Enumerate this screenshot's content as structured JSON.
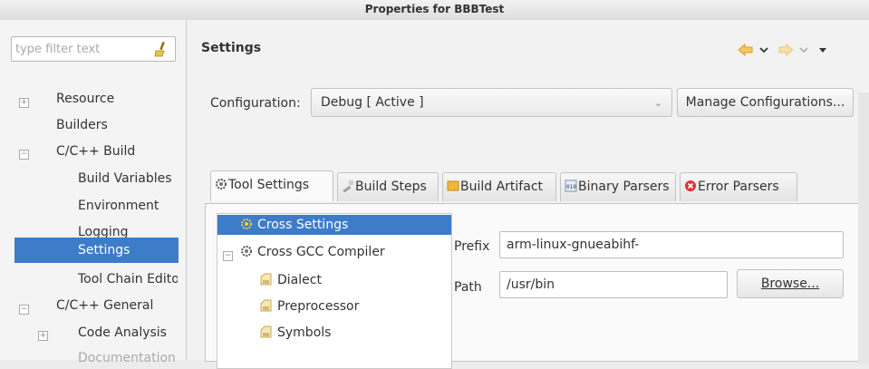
{
  "window": {
    "title": "Properties for BBBTest"
  },
  "filter": {
    "placeholder": "type filter text",
    "icon": "clear-filter-icon"
  },
  "nav_tree": [
    {
      "label": "Resource",
      "expander": "+"
    },
    {
      "label": "Builders"
    },
    {
      "label": "C/C++ Build",
      "expander": "−"
    },
    {
      "label": "Build Variables"
    },
    {
      "label": "Environment"
    },
    {
      "label": "Logging"
    },
    {
      "label": "Settings",
      "selected": true
    },
    {
      "label": "Tool Chain Edito"
    },
    {
      "label": "C/C++ General",
      "expander": "−"
    },
    {
      "label": "Code Analysis",
      "expander": "+"
    },
    {
      "label": "Documentation"
    }
  ],
  "page": {
    "title": "Settings"
  },
  "configuration": {
    "label": "Configuration:",
    "value": "Debug  [ Active ]",
    "manage_button": "Manage Configurations..."
  },
  "tabs": [
    {
      "label": "Tool Settings",
      "icon": "gear-icon",
      "active": true
    },
    {
      "label": "Build Steps",
      "icon": "hammer-icon"
    },
    {
      "label": "Build Artifact",
      "icon": "artifact-icon"
    },
    {
      "label": "Binary Parsers",
      "icon": "binary-icon"
    },
    {
      "label": "Error Parsers",
      "icon": "error-icon"
    }
  ],
  "settings_tree": [
    {
      "label": "Cross Settings",
      "selected": true
    },
    {
      "label": "Cross GCC Compiler",
      "expander": "−"
    },
    {
      "label": "Dialect"
    },
    {
      "label": "Preprocessor"
    },
    {
      "label": "Symbols"
    }
  ],
  "fields": {
    "prefix_label": "Prefix",
    "prefix_value": "arm-linux-gnueabihf-",
    "path_label": "Path",
    "path_value": "/usr/bin",
    "browse_button": "Browse..."
  },
  "colors": {
    "selection": "#3d7cc8",
    "nav_arrow": "#e8a317",
    "error": "#e03030"
  }
}
